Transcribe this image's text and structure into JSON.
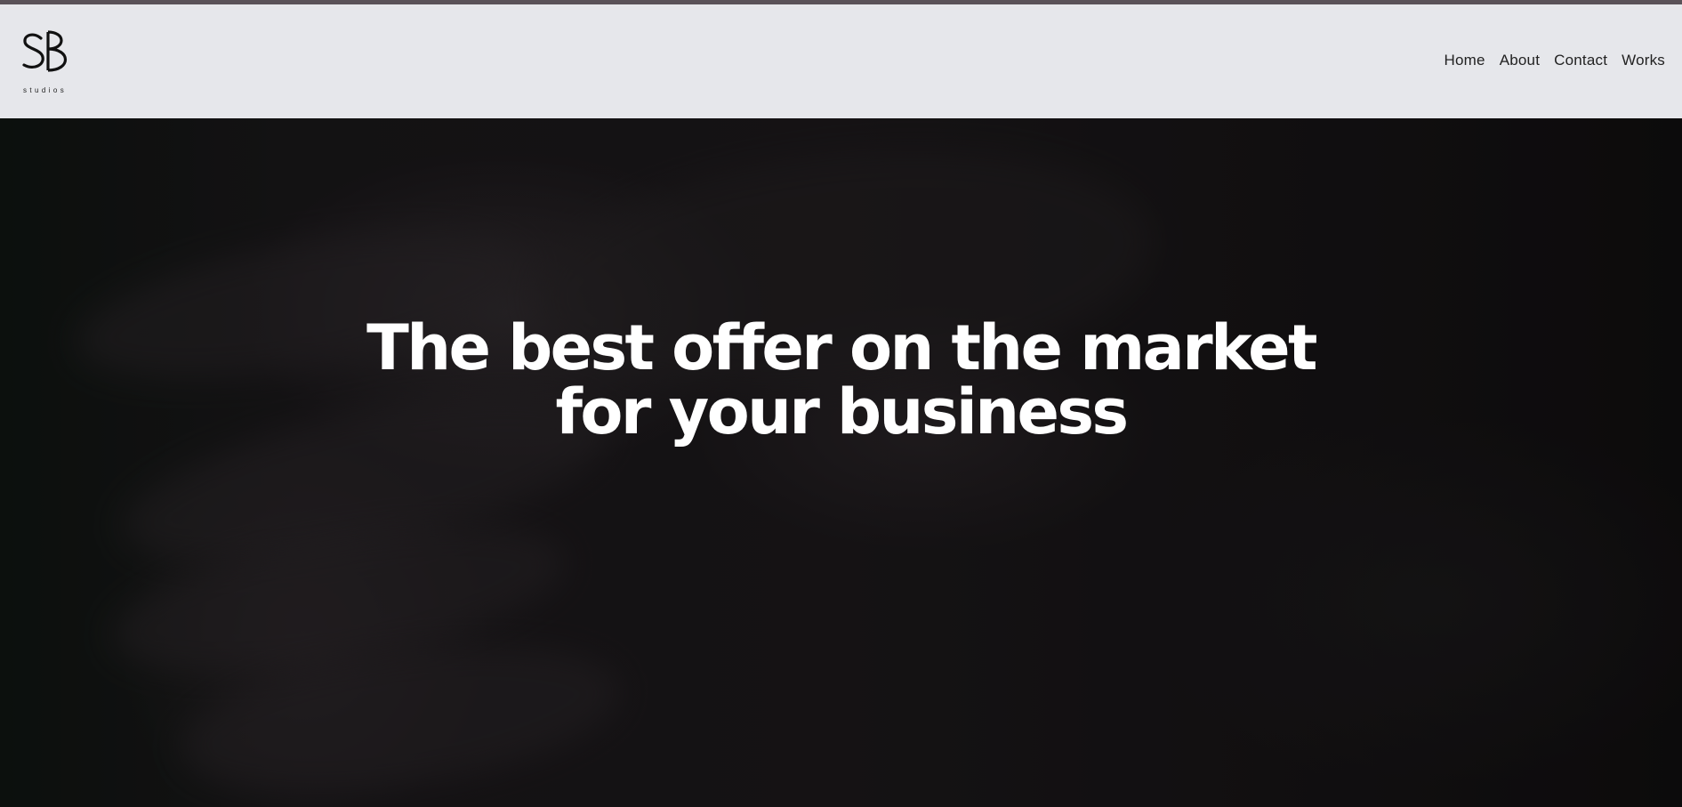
{
  "logo": {
    "mark": "SB",
    "subtitle": "studios"
  },
  "nav": {
    "items": [
      {
        "label": "Home"
      },
      {
        "label": "About"
      },
      {
        "label": "Contact"
      },
      {
        "label": "Works"
      }
    ]
  },
  "hero": {
    "title_line1": "The best offer on the market",
    "title_line2": "for your business"
  },
  "colors": {
    "navbar_bg": "#e6e7eb",
    "hero_text": "#ffffff",
    "top_strip": "#5a5258"
  }
}
